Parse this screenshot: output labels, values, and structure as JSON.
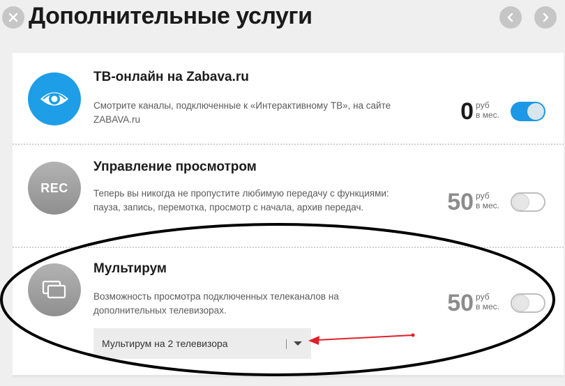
{
  "header": {
    "title": "Дополнительные услуги",
    "close_icon": "close-icon",
    "prev_icon": "chevron-left-icon",
    "next_icon": "chevron-right-icon"
  },
  "services": [
    {
      "title": "ТВ-онлайн на Zabava.ru",
      "description": "Смотрите каналы, подключенные к «Интерактивному ТВ», на сайте ZABAVA.ru",
      "price": "0",
      "price_currency": "руб",
      "price_period": "в мес.",
      "enabled": true,
      "icon": "eye-icon"
    },
    {
      "title": "Управление просмотром",
      "description": "Теперь вы никогда не пропустите любимую передачу с функциями: пауза, запись, перемотка, просмотр с начала, архив передач.",
      "price": "50",
      "price_currency": "руб",
      "price_period": "в мес.",
      "enabled": false,
      "icon": "rec-icon",
      "icon_text": "REC"
    },
    {
      "title": "Мультирум",
      "description": "Возможность просмотра подключенных телеканалов на дополнительных телевизорах.",
      "price": "50",
      "price_currency": "руб",
      "price_period": "в мес.",
      "enabled": false,
      "icon": "multiscreen-icon",
      "select_value": "Мультирум на 2 телевизора"
    }
  ],
  "colors": {
    "accent": "#1d9ee6",
    "annotation_red": "#e0202a"
  }
}
